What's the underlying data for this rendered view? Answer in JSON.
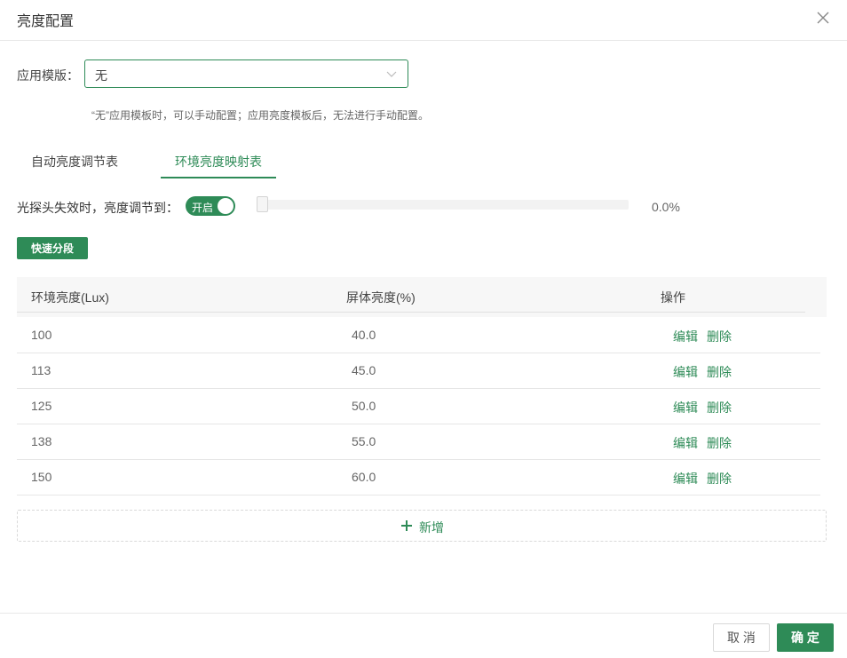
{
  "dialog": {
    "title": "亮度配置",
    "close_icon": "close-icon"
  },
  "template": {
    "label": "应用模版：",
    "value": "无",
    "hint": "“无”应用模板时，可以手动配置；应用亮度模板后，无法进行手动配置。"
  },
  "tabs": [
    {
      "label": "自动亮度调节表",
      "active": false
    },
    {
      "label": "环境亮度映射表",
      "active": true
    }
  ],
  "sensor_fail": {
    "label": "光探头失效时，亮度调节到：",
    "toggle_text": "开启",
    "toggle_on": true,
    "slider_value": "0.0%",
    "slider_fraction": 0
  },
  "quick_button": "快速分段",
  "table": {
    "headers": [
      "环境亮度(Lux)",
      "屏体亮度(%)",
      "操作"
    ],
    "rows": [
      {
        "lux": "100",
        "screen": "40.0",
        "edit": "编辑",
        "delete": "删除"
      },
      {
        "lux": "113",
        "screen": "45.0",
        "edit": "编辑",
        "delete": "删除"
      },
      {
        "lux": "125",
        "screen": "50.0",
        "edit": "编辑",
        "delete": "删除"
      },
      {
        "lux": "138",
        "screen": "55.0",
        "edit": "编辑",
        "delete": "删除"
      },
      {
        "lux": "150",
        "screen": "60.0",
        "edit": "编辑",
        "delete": "删除"
      }
    ]
  },
  "add_label": "新增",
  "footer": {
    "cancel": "取 消",
    "ok": "确 定"
  },
  "colors": {
    "accent": "#2e8b57",
    "text": "#333333",
    "muted": "#666666",
    "border": "#e6e6e6"
  }
}
